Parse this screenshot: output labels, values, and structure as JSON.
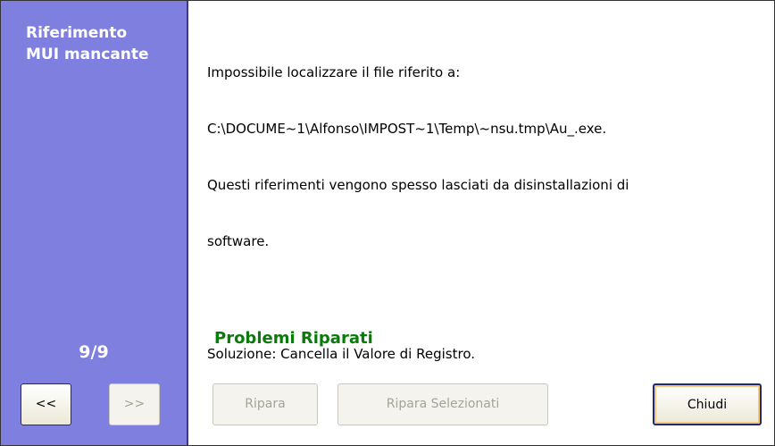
{
  "sidebar": {
    "title_line1": "Riferimento",
    "title_line2": "MUI mancante",
    "counter": "9/9",
    "prev_label": "<<",
    "next_label": ">>"
  },
  "message": {
    "line1": "Impossibile localizzare il file riferito a:",
    "line2": "C:\\DOCUME~1\\Alfonso\\IMPOST~1\\Temp\\~nsu.tmp\\Au_.exe.",
    "line3": "Questi riferimenti vengono spesso lasciati da disinstallazioni di",
    "line4": "software.",
    "solution": "Soluzione: Cancella il Valore di Registro."
  },
  "status": {
    "text": "Problemi Riparati",
    "color": "#0a7a0a"
  },
  "buttons": {
    "repair": "Ripara",
    "repair_selected": "Ripara Selezionati",
    "close": "Chiudi"
  },
  "colors": {
    "sidebar_bg": "#7f7fe0",
    "content_bg": "#ffffff"
  }
}
